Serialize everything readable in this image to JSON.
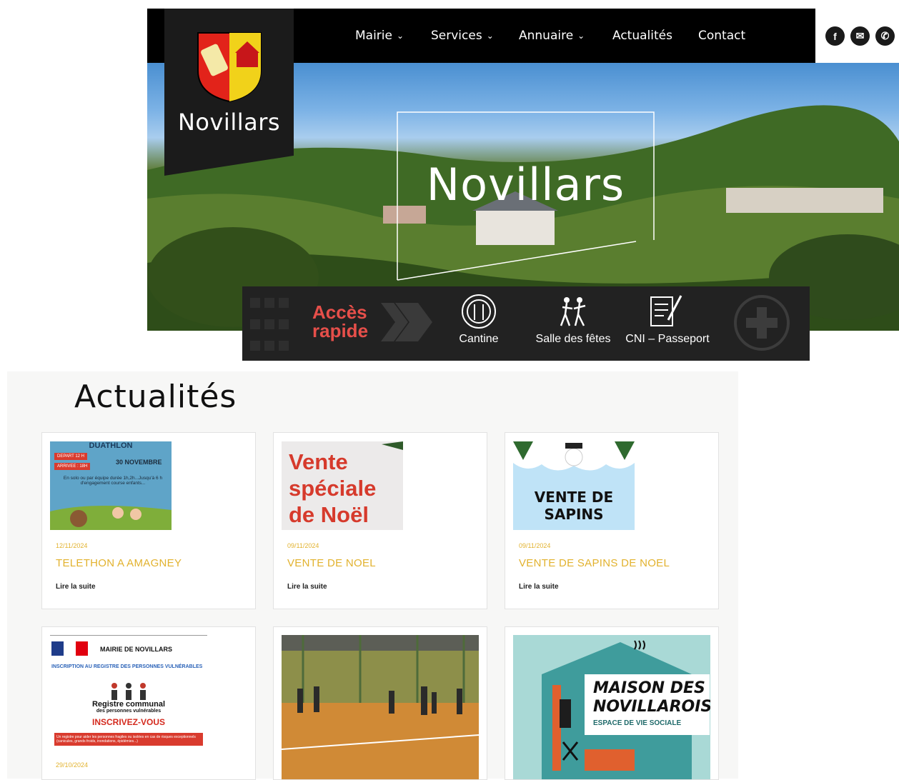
{
  "site": {
    "name": "Novillars"
  },
  "nav": {
    "items": [
      {
        "label": "Mairie",
        "has_menu": true
      },
      {
        "label": "Services",
        "has_menu": true
      },
      {
        "label": "Annuaire",
        "has_menu": true
      },
      {
        "label": "Actualités",
        "has_menu": false
      },
      {
        "label": "Contact",
        "has_menu": false
      }
    ],
    "social": [
      {
        "icon": "facebook-icon",
        "glyph": "f"
      },
      {
        "icon": "mail-icon",
        "glyph": "✉"
      },
      {
        "icon": "phone-icon",
        "glyph": "✆"
      }
    ]
  },
  "hero": {
    "title": "Novillars"
  },
  "quick_access": {
    "label_line1": "Accès",
    "label_line2": "rapide",
    "items": [
      {
        "label": "Cantine",
        "icon": "cutlery-icon"
      },
      {
        "label": "Salle des fêtes",
        "icon": "dancing-icon"
      },
      {
        "label": "CNI – Passeport",
        "icon": "document-pen-icon"
      }
    ],
    "more_icon": "plus-circle-icon"
  },
  "news": {
    "title": "Actualités",
    "read_more": "Lire la suite",
    "cards": [
      {
        "date": "12/11/2024",
        "title": "TELETHON A AMAGNEY",
        "image_text": {
          "heading": "DUATHLON",
          "badge1": "DEPART 12 H",
          "badge2": "ARRIVEE : 18H",
          "date": "30 NOVEMBRE",
          "body": "En solo ou par équipe durée 1h,2h...Jusqu'à 6 h d'engagement course enfants..."
        }
      },
      {
        "date": "09/11/2024",
        "title": "VENTE DE NOEL",
        "image_text": {
          "line1": "Vente",
          "line2": "spéciale",
          "line3": "de Noël"
        }
      },
      {
        "date": "09/11/2024",
        "title": "VENTE DE SAPINS DE NOEL",
        "image_text": {
          "line1": "VENTE DE",
          "line2": "SAPINS"
        }
      },
      {
        "date": "29/10/2024",
        "title": "",
        "image_text": {
          "header": "MAIRIE DE NOVILLARS",
          "subtitle": "INSCRIPTION AU REGISTRE DES PERSONNES VULNÉRABLES",
          "reg1": "Registre communal",
          "reg2": "des personnes vulnérables",
          "cta": "INSCRIVEZ-VOUS",
          "footer": "Un registre pour aider les personnes fragiles ou isolées en cas de risques exceptionnels (canicules, grands froids, inondations, épidémies...)"
        }
      },
      {
        "date": "",
        "title": "",
        "image_text": {}
      },
      {
        "date": "",
        "title": "",
        "image_text": {
          "line1": "MAISON DES",
          "line2": "NOVILLAROIS",
          "line3": "ESPACE DE VIE SOCIALE"
        }
      }
    ]
  },
  "colors": {
    "accent_red": "#e64f4a",
    "accent_gold": "#e2b22e",
    "dark": "#1b1b1b"
  }
}
